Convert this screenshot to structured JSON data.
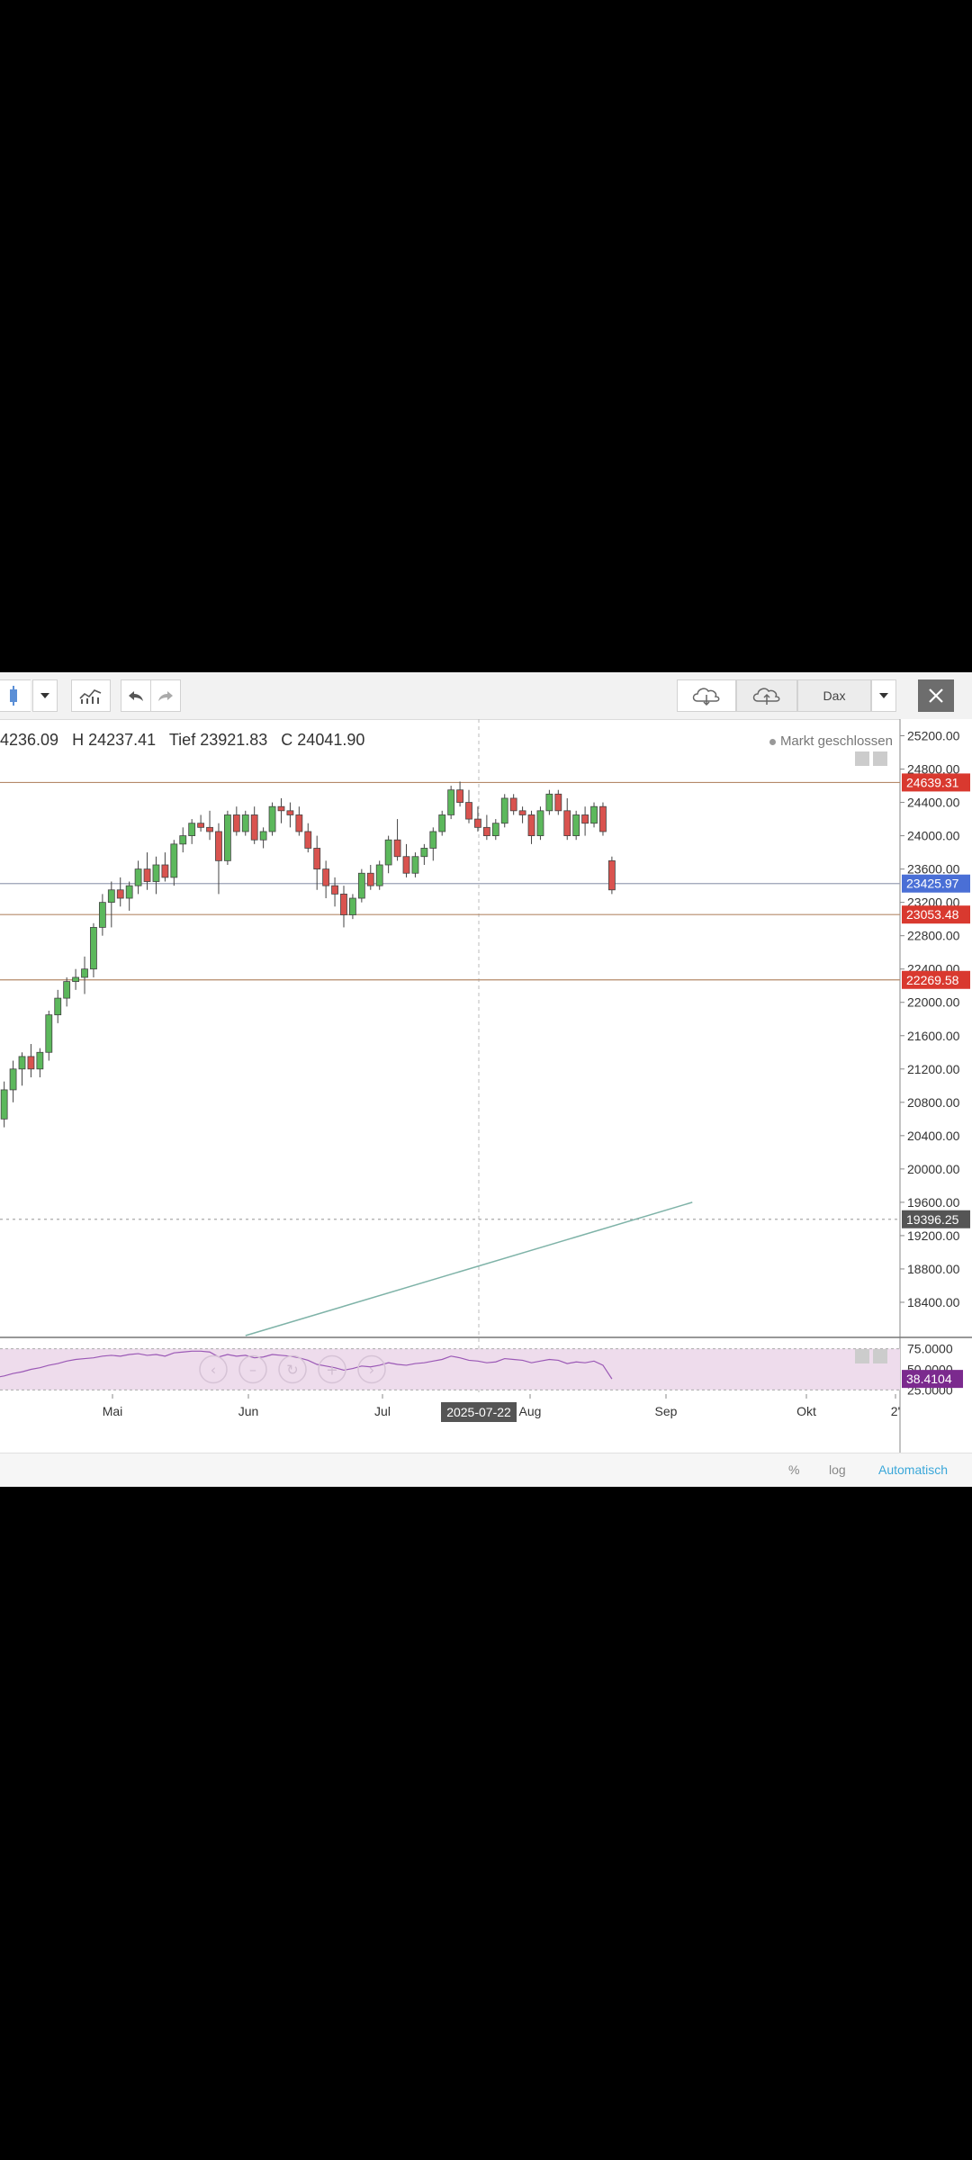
{
  "toolbar": {
    "symbol": "Dax",
    "icons": [
      "candlestick-chart-icon",
      "dropdown-arrow-icon",
      "indicators-icon",
      "undo-icon",
      "redo-icon",
      "cloud-download-icon",
      "cloud-upload-icon",
      "close-icon"
    ]
  },
  "ohlc": {
    "open": "4236.09",
    "high": "H 24237.41",
    "low": "Tief 23921.83",
    "close": "C 24041.90"
  },
  "market_status": "Markt geschlossen",
  "crosshair_date": "2025-07-22",
  "footer": {
    "percent": "%",
    "log": "log",
    "auto": "Automatisch"
  },
  "colors": {
    "up": "#5cb85c",
    "down": "#d9534f",
    "accent": "#4a90e2",
    "rsi_band": "#eedcec",
    "rsi_line": "#9b59b6"
  },
  "chart_data": {
    "type": "candlestick",
    "price_axis": {
      "ylim": [
        18000,
        25400
      ],
      "ticks": [
        25200,
        24800,
        24400,
        24000,
        23600,
        23200,
        22800,
        22400,
        22000,
        21600,
        21200,
        20800,
        20400,
        20000,
        19600,
        19200,
        18800,
        18400
      ],
      "tick_labels": [
        "25200.00",
        "24800.00",
        "24400.00",
        "24000.00",
        "23600.00",
        "23200.00",
        "22800.00",
        "22400.00",
        "22000.00",
        "21600.00",
        "21200.00",
        "20800.00",
        "20400.00",
        "20000.00",
        "19600.00",
        "19200.00",
        "18800.00",
        "18400.00"
      ]
    },
    "x_axis": {
      "tick_labels": [
        "Mai",
        "Jun",
        "Jul",
        "Aug",
        "Sep",
        "Okt",
        "2'"
      ]
    },
    "horizontal_levels": [
      {
        "value": 24639.31,
        "label": "24639.31",
        "color": "#d9392f"
      },
      {
        "value": 23425.97,
        "label": "23425.97",
        "color": "#4a6fd6"
      },
      {
        "value": 23053.48,
        "label": "23053.48",
        "color": "#d9392f"
      },
      {
        "value": 22269.58,
        "label": "22269.58",
        "color": "#d9392f"
      },
      {
        "value": 19396.25,
        "label": "19396.25",
        "color": "#555555"
      }
    ],
    "trendline": {
      "from": [
        32,
        18000
      ],
      "to": [
        82,
        19600
      ]
    },
    "candles": [
      [
        21400,
        21500,
        20600,
        20800
      ],
      [
        19800,
        20800,
        19500,
        20600
      ],
      [
        20600,
        20800,
        20000,
        20200
      ],
      [
        20200,
        20450,
        20000,
        20300
      ],
      [
        20300,
        20700,
        20100,
        20600
      ],
      [
        20600,
        21050,
        20500,
        20950
      ],
      [
        20950,
        21300,
        20800,
        21200
      ],
      [
        21200,
        21400,
        21000,
        21350
      ],
      [
        21350,
        21500,
        21100,
        21200
      ],
      [
        21200,
        21450,
        21100,
        21400
      ],
      [
        21400,
        21900,
        21300,
        21850
      ],
      [
        21850,
        22150,
        21750,
        22050
      ],
      [
        22050,
        22300,
        21950,
        22250
      ],
      [
        22250,
        22400,
        22150,
        22300
      ],
      [
        22300,
        22550,
        22100,
        22400
      ],
      [
        22400,
        22950,
        22300,
        22900
      ],
      [
        22900,
        23300,
        22800,
        23200
      ],
      [
        23200,
        23450,
        22900,
        23350
      ],
      [
        23350,
        23500,
        23150,
        23250
      ],
      [
        23250,
        23450,
        23100,
        23400
      ],
      [
        23400,
        23700,
        23300,
        23600
      ],
      [
        23600,
        23800,
        23350,
        23450
      ],
      [
        23450,
        23750,
        23300,
        23650
      ],
      [
        23650,
        23800,
        23450,
        23500
      ],
      [
        23500,
        23950,
        23400,
        23900
      ],
      [
        23900,
        24100,
        23800,
        24000
      ],
      [
        24000,
        24200,
        23900,
        24150
      ],
      [
        24150,
        24250,
        24050,
        24100
      ],
      [
        24100,
        24300,
        23950,
        24050
      ],
      [
        24050,
        24150,
        23300,
        23700
      ],
      [
        23700,
        24300,
        23650,
        24250
      ],
      [
        24250,
        24350,
        24000,
        24050
      ],
      [
        24050,
        24300,
        24000,
        24250
      ],
      [
        24250,
        24350,
        23900,
        23950
      ],
      [
        23950,
        24100,
        23850,
        24050
      ],
      [
        24050,
        24400,
        24000,
        24350
      ],
      [
        24350,
        24450,
        24150,
        24300
      ],
      [
        24300,
        24400,
        24100,
        24250
      ],
      [
        24250,
        24350,
        24000,
        24050
      ],
      [
        24050,
        24150,
        23800,
        23850
      ],
      [
        23850,
        24000,
        23350,
        23600
      ],
      [
        23600,
        23700,
        23250,
        23400
      ],
      [
        23400,
        23500,
        23150,
        23300
      ],
      [
        23300,
        23400,
        22900,
        23050
      ],
      [
        23050,
        23300,
        23000,
        23250
      ],
      [
        23250,
        23600,
        23200,
        23550
      ],
      [
        23550,
        23650,
        23350,
        23400
      ],
      [
        23400,
        23700,
        23350,
        23650
      ],
      [
        23650,
        24000,
        23550,
        23950
      ],
      [
        23950,
        24200,
        23700,
        23750
      ],
      [
        23750,
        23900,
        23500,
        23550
      ],
      [
        23550,
        23800,
        23500,
        23750
      ],
      [
        23750,
        23900,
        23650,
        23850
      ],
      [
        23850,
        24100,
        23700,
        24050
      ],
      [
        24050,
        24300,
        24000,
        24250
      ],
      [
        24250,
        24600,
        24200,
        24550
      ],
      [
        24550,
        24650,
        24350,
        24400
      ],
      [
        24400,
        24550,
        24150,
        24200
      ],
      [
        24200,
        24350,
        24050,
        24100
      ],
      [
        24100,
        24250,
        23950,
        24000
      ],
      [
        24000,
        24200,
        23950,
        24150
      ],
      [
        24150,
        24500,
        24100,
        24450
      ],
      [
        24450,
        24500,
        24250,
        24300
      ],
      [
        24300,
        24350,
        24150,
        24250
      ],
      [
        24250,
        24300,
        23900,
        24000
      ],
      [
        24000,
        24350,
        23950,
        24300
      ],
      [
        24300,
        24550,
        24250,
        24500
      ],
      [
        24500,
        24550,
        24250,
        24300
      ],
      [
        24300,
        24450,
        23950,
        24000
      ],
      [
        24000,
        24300,
        23950,
        24250
      ],
      [
        24250,
        24350,
        24000,
        24150
      ],
      [
        24150,
        24400,
        24100,
        24350
      ],
      [
        24350,
        24400,
        24000,
        24050
      ],
      [
        23700,
        23750,
        23300,
        23350
      ]
    ],
    "rsi": {
      "ylim": [
        20,
        80
      ],
      "ticks": [
        75,
        50,
        25
      ],
      "tick_labels": [
        "75.0000",
        "50.0000",
        "25.0000"
      ],
      "last_label": "38.4104",
      "values": [
        35,
        30,
        38,
        36,
        40,
        42,
        45,
        47,
        50,
        52,
        55,
        57,
        60,
        62,
        63,
        64,
        66,
        67,
        66,
        68,
        69,
        67,
        68,
        66,
        70,
        71,
        72,
        72,
        71,
        65,
        68,
        66,
        67,
        64,
        65,
        68,
        67,
        66,
        64,
        61,
        56,
        54,
        52,
        49,
        51,
        54,
        53,
        55,
        58,
        56,
        55,
        57,
        58,
        60,
        62,
        66,
        64,
        61,
        60,
        58,
        59,
        63,
        62,
        61,
        58,
        60,
        62,
        61,
        57,
        59,
        58,
        60,
        55,
        38.4
      ]
    }
  }
}
